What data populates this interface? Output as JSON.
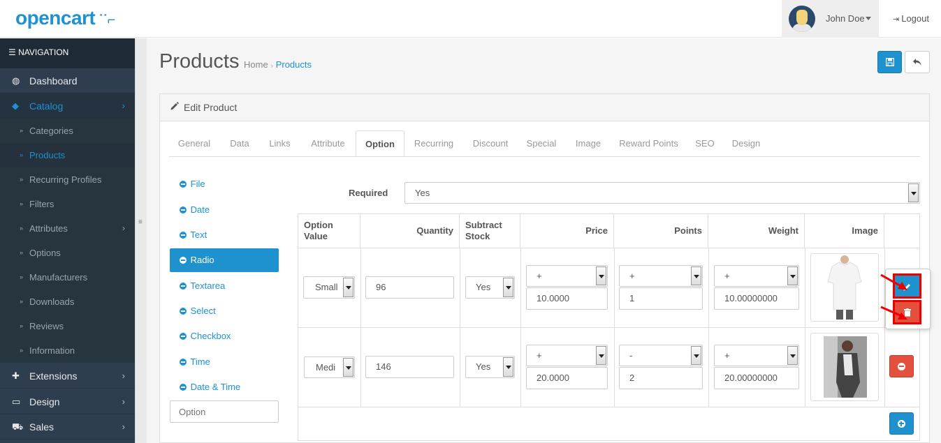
{
  "header": {
    "logo": "opencart",
    "user_name": "John Doe",
    "logout_label": "Logout"
  },
  "sidebar": {
    "nav_title": "NAVIGATION",
    "items": [
      {
        "label": "Dashboard",
        "icon": "dashboard-icon"
      },
      {
        "label": "Catalog",
        "icon": "tag-icon"
      },
      {
        "label": "Extensions",
        "icon": "puzzle-icon"
      },
      {
        "label": "Design",
        "icon": "monitor-icon"
      },
      {
        "label": "Sales",
        "icon": "cart-icon"
      }
    ],
    "catalog_sub": [
      "Categories",
      "Products",
      "Recurring Profiles",
      "Filters",
      "Attributes",
      "Options",
      "Manufacturers",
      "Downloads",
      "Reviews",
      "Information"
    ]
  },
  "page": {
    "title": "Products",
    "breadcrumb_home": "Home",
    "breadcrumb_current": "Products"
  },
  "panel": {
    "title": "Edit Product"
  },
  "tabs": [
    "General",
    "Data",
    "Links",
    "Attribute",
    "Option",
    "Recurring",
    "Discount",
    "Special",
    "Image",
    "Reward Points",
    "SEO",
    "Design"
  ],
  "options_list": [
    "File",
    "Date",
    "Text",
    "Radio",
    "Textarea",
    "Select",
    "Checkbox",
    "Time",
    "Date & Time"
  ],
  "option_input_placeholder": "Option",
  "required": {
    "label": "Required",
    "value": "Yes"
  },
  "table": {
    "headers": [
      "Option Value",
      "Quantity",
      "Subtract Stock",
      "Price",
      "Points",
      "Weight",
      "Image"
    ],
    "rows": [
      {
        "option_value": "Small",
        "quantity": "96",
        "subtract": "Yes",
        "price_prefix": "+",
        "price": "10.0000",
        "points_prefix": "+",
        "points": "1",
        "weight_prefix": "+",
        "weight": "10.00000000"
      },
      {
        "option_value": "Medi",
        "quantity": "146",
        "subtract": "Yes",
        "price_prefix": "+",
        "price": "20.0000",
        "points_prefix": "-",
        "points": "2",
        "weight_prefix": "+",
        "weight": "20.00000000"
      }
    ]
  },
  "colors": {
    "accent": "#1e91cf",
    "danger": "#e3503e",
    "sidebar": "#2e3e4e",
    "highlight": "#ee0000"
  }
}
